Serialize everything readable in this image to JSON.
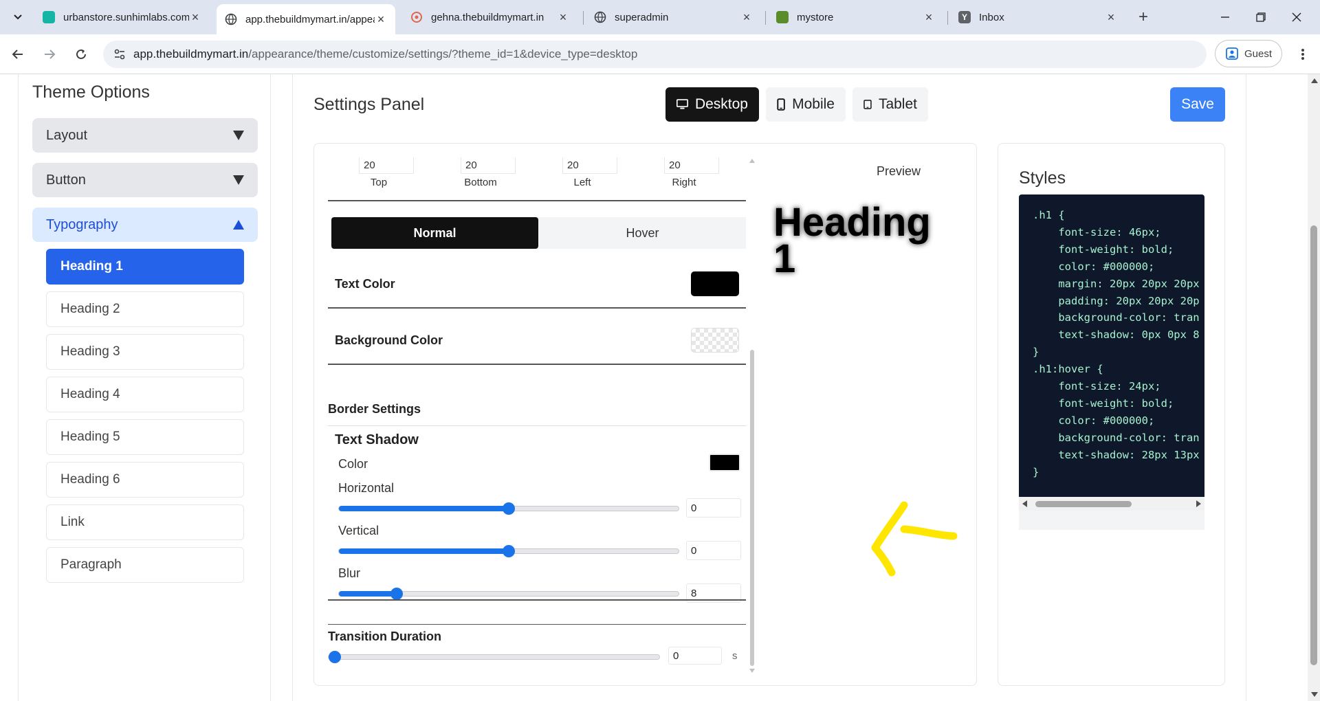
{
  "browser": {
    "tabs": [
      {
        "title": "urbanstore.sunhimlabs.com",
        "icon": "store-favicon",
        "close": "×"
      },
      {
        "title": "app.thebuildmymart.in/appearance",
        "icon": "globe-icon",
        "close": "×"
      },
      {
        "title": "gehna.thebuildmymart.in",
        "icon": "gehna-favicon",
        "close": "×"
      },
      {
        "title": "superadmin",
        "icon": "globe-icon",
        "close": "×"
      },
      {
        "title": "mystore",
        "icon": "mystore-favicon",
        "close": "×"
      },
      {
        "title": "Inbox",
        "icon": "yahoo-favicon",
        "close": "×"
      }
    ],
    "new_tab": "+",
    "url_host": "app.thebuildmymart.in",
    "url_path": "/appearance/theme/customize/settings/?theme_id=1&device_type=desktop",
    "profile_label": "Guest"
  },
  "sidebar": {
    "title": "Theme Options",
    "accordions": [
      {
        "label": "Layout"
      },
      {
        "label": "Button"
      },
      {
        "label": "Typography"
      }
    ],
    "typography_items": [
      {
        "label": "Heading 1"
      },
      {
        "label": "Heading 2"
      },
      {
        "label": "Heading 3"
      },
      {
        "label": "Heading 4"
      },
      {
        "label": "Heading 5"
      },
      {
        "label": "Heading 6"
      },
      {
        "label": "Link"
      },
      {
        "label": "Paragraph"
      }
    ]
  },
  "header": {
    "title": "Settings Panel",
    "devices": [
      {
        "label": "Desktop",
        "icon": "desktop-icon"
      },
      {
        "label": "Mobile",
        "icon": "mobile-icon"
      },
      {
        "label": "Tablet",
        "icon": "tablet-icon"
      }
    ],
    "save_label": "Save"
  },
  "settings": {
    "spacing": [
      {
        "value": "20",
        "label": "Top"
      },
      {
        "value": "20",
        "label": "Bottom"
      },
      {
        "value": "20",
        "label": "Left"
      },
      {
        "value": "20",
        "label": "Right"
      }
    ],
    "states": {
      "normal": "Normal",
      "hover": "Hover"
    },
    "text_color_label": "Text Color",
    "text_color": "#000000",
    "background_color_label": "Background Color",
    "border_settings_label": "Border Settings",
    "text_shadow": {
      "title": "Text Shadow",
      "color_label": "Color",
      "color": "#000000",
      "horizontal_label": "Horizontal",
      "horizontal": "0",
      "horizontal_level": 0.5,
      "vertical_label": "Vertical",
      "vertical": "0",
      "vertical_level": 0.5,
      "blur_label": "Blur",
      "blur": "8",
      "blur_level": 0.17
    },
    "transition_label": "Transition Duration",
    "transition": "0",
    "transition_unit": "s"
  },
  "preview": {
    "label": "Preview",
    "heading": "Heading 1"
  },
  "styles": {
    "title": "Styles",
    "code_lines": [
      ".h1 {",
      "    font-size: 46px;",
      "    font-weight: bold;",
      "    color: #000000;",
      "    margin: 20px 20px 20px",
      "    padding: 20px 20px 20p",
      "    background-color: tran",
      "    text-shadow: 0px 0px 8",
      "}",
      ".h1:hover {",
      "    font-size: 24px;",
      "    font-weight: bold;",
      "    color: #000000;",
      "    background-color: tran",
      "    text-shadow: 28px 13px",
      "}"
    ]
  },
  "colors": {
    "accent": "#2563eb",
    "save": "#3b82f6",
    "code_bg": "#0f172a",
    "code_text": "#a7f3d0",
    "annotation": "#ffe600"
  }
}
